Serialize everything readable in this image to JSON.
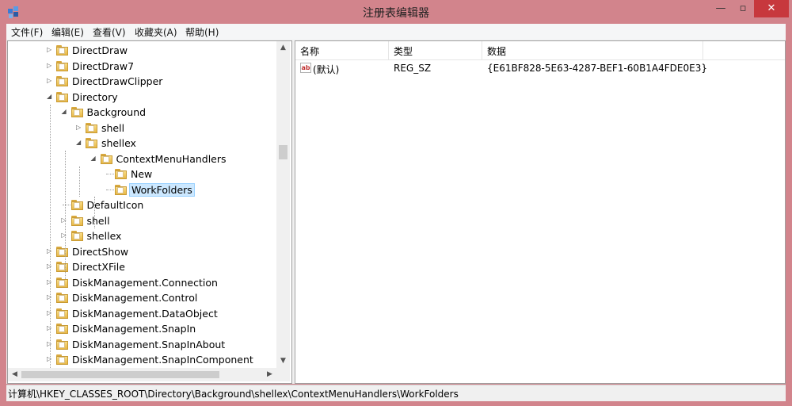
{
  "window": {
    "title": "注册表编辑器",
    "controls": {
      "minimize": "—",
      "maximize": "▫",
      "close": "✕"
    }
  },
  "menu": [
    {
      "label": "文件(F)"
    },
    {
      "label": "编辑(E)"
    },
    {
      "label": "查看(V)"
    },
    {
      "label": "收藏夹(A)"
    },
    {
      "label": "帮助(H)"
    }
  ],
  "tree": {
    "rows": [
      {
        "label": "DirectDraw",
        "expander": "collapsed",
        "selected": false
      },
      {
        "label": "DirectDraw7",
        "expander": "collapsed",
        "selected": false
      },
      {
        "label": "DirectDrawClipper",
        "expander": "collapsed",
        "selected": false
      },
      {
        "label": "Directory",
        "expander": "expanded",
        "selected": false
      },
      {
        "label": "Background",
        "expander": "expanded",
        "selected": false
      },
      {
        "label": "shell",
        "expander": "collapsed",
        "selected": false
      },
      {
        "label": "shellex",
        "expander": "expanded",
        "selected": false
      },
      {
        "label": "ContextMenuHandlers",
        "expander": "expanded",
        "selected": false
      },
      {
        "label": "New",
        "expander": "none",
        "selected": false
      },
      {
        "label": "WorkFolders",
        "expander": "none",
        "selected": true
      },
      {
        "label": "DefaultIcon",
        "expander": "none",
        "selected": false
      },
      {
        "label": "shell",
        "expander": "collapsed",
        "selected": false
      },
      {
        "label": "shellex",
        "expander": "collapsed",
        "selected": false
      },
      {
        "label": "DirectShow",
        "expander": "collapsed",
        "selected": false
      },
      {
        "label": "DirectXFile",
        "expander": "collapsed",
        "selected": false
      },
      {
        "label": "DiskManagement.Connection",
        "expander": "collapsed",
        "selected": false
      },
      {
        "label": "DiskManagement.Control",
        "expander": "collapsed",
        "selected": false
      },
      {
        "label": "DiskManagement.DataObject",
        "expander": "collapsed",
        "selected": false
      },
      {
        "label": "DiskManagement.SnapIn",
        "expander": "collapsed",
        "selected": false
      },
      {
        "label": "DiskManagement.SnapInAbout",
        "expander": "collapsed",
        "selected": false
      },
      {
        "label": "DiskManagement.SnapInComponent",
        "expander": "collapsed",
        "selected": false
      }
    ]
  },
  "list": {
    "columns": [
      "名称",
      "类型",
      "数据"
    ],
    "rows": [
      {
        "icon": "string-value-icon",
        "name": "(默认)",
        "type": "REG_SZ",
        "data": "{E61BF828-5E63-4287-BEF1-60B1A4FDE0E3}"
      }
    ]
  },
  "status": {
    "path": "计算机\\HKEY_CLASSES_ROOT\\Directory\\Background\\shellex\\ContextMenuHandlers\\WorkFolders"
  },
  "colors": {
    "frame": "#d2848c",
    "close": "#c7383d",
    "selection": "#cce8ff",
    "folder": "#f0c75e"
  }
}
